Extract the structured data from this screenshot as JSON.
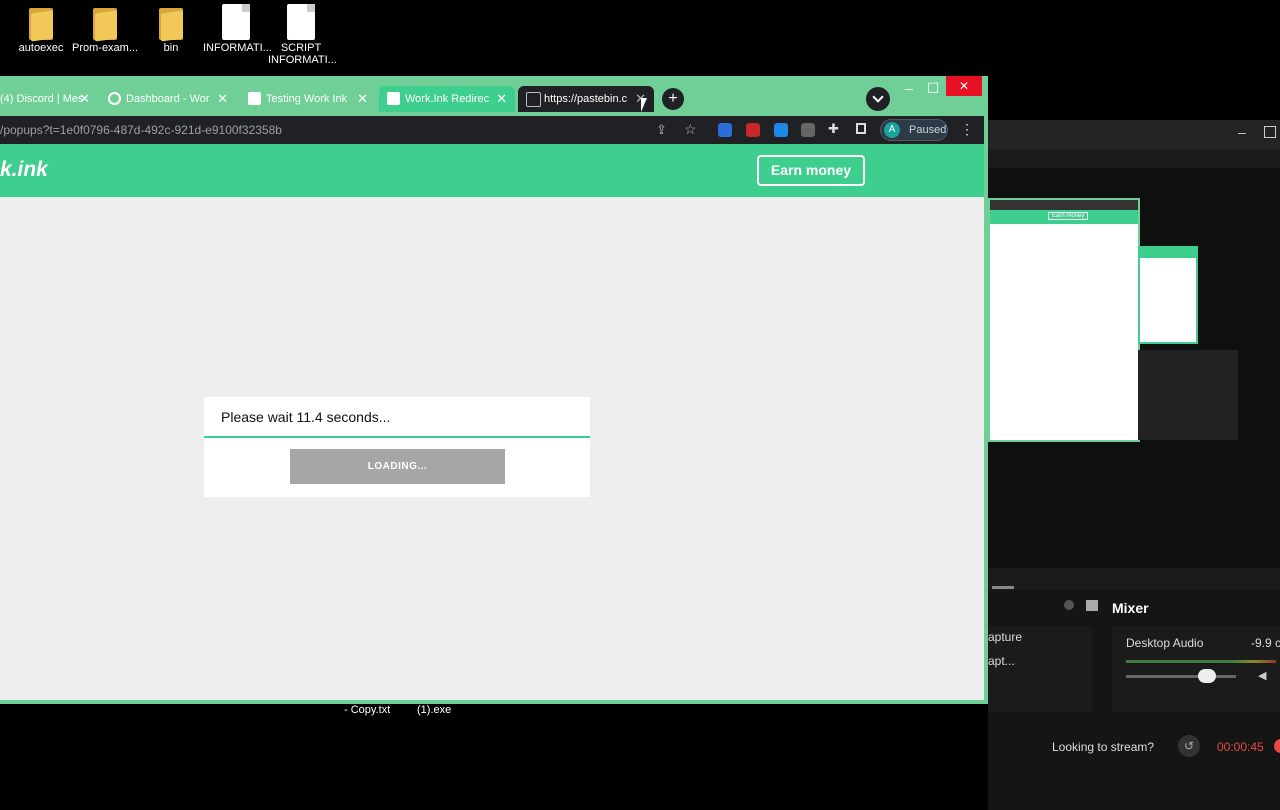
{
  "desktop": {
    "icons": [
      {
        "label": "autoexec",
        "type": "folder"
      },
      {
        "label": "Prom-exam...",
        "type": "folder"
      },
      {
        "label": "bin",
        "type": "folder"
      },
      {
        "label": "INFORMATI...",
        "type": "file"
      },
      {
        "label": "SCRIPT INFORMATI...",
        "type": "file"
      }
    ]
  },
  "browser": {
    "tabs": [
      {
        "label": "(4) Discord | Mes"
      },
      {
        "label": "Dashboard - Work"
      },
      {
        "label": "Testing Work Ink -"
      },
      {
        "label": "Work.Ink Redirect"
      },
      {
        "label": "https://pastebin.c"
      }
    ],
    "url": "/popups?t=1e0f0796-487d-492c-921d-e9100f32358b",
    "profile": {
      "initial": "A",
      "status": "Paused"
    },
    "window_controls": {
      "minimize": "–",
      "maximize": "☐",
      "close": "✕"
    }
  },
  "site": {
    "logo": "k.ink",
    "earn_button": "Earn money",
    "wait_text": "Please wait 11.4 seconds...",
    "loading_button": "LOADING..."
  },
  "obs": {
    "mixer_label": "Mixer",
    "sources": [
      "apture",
      "apt..."
    ],
    "audio_source": "Desktop Audio",
    "audio_level": "-9.9 c",
    "stream_prompt": "Looking to stream?",
    "timer": "00:00:45",
    "preview_button": "Earn money"
  },
  "taskbar": {
    "items": [
      "- Copy.txt",
      "(1).exe"
    ]
  },
  "colors": {
    "accent": "#3ecf8e",
    "window_frame": "#6fcf97",
    "timer_red": "#e84a4a"
  }
}
